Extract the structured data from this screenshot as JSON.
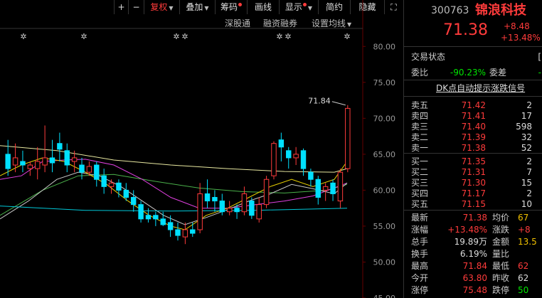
{
  "toolbar": {
    "plus": "+",
    "minus": "−",
    "fuquan": "复权",
    "diejia": "叠加",
    "chouma": "筹码",
    "huaxian": "画线",
    "xianshi": "显示",
    "jianyue": "简约",
    "yincang": "隐藏",
    "expand": "⛶"
  },
  "subbar": {
    "shentongtong": "深股通",
    "rongzi": "融资融券",
    "shezhi": "设置均线"
  },
  "chart_data": {
    "type": "candlestick",
    "y_ticks": [
      "80.00",
      "75.00",
      "70.00",
      "65.00",
      "60.00",
      "55.00",
      "50.00",
      "45.00"
    ],
    "ylim": [
      45,
      82.5
    ],
    "last_price_label": "71.84",
    "candles": [
      {
        "o": 65.0,
        "c": 63.0,
        "h": 67.0,
        "l": 62.0
      },
      {
        "o": 63.5,
        "c": 64.5,
        "h": 66.5,
        "l": 62.5
      },
      {
        "o": 64.0,
        "c": 63.5,
        "h": 65.5,
        "l": 62.5
      },
      {
        "o": 63.0,
        "c": 63.5,
        "h": 64.0,
        "l": 62.0
      },
      {
        "o": 63.0,
        "c": 64.0,
        "h": 66.0,
        "l": 61.5
      },
      {
        "o": 63.5,
        "c": 64.5,
        "h": 69.0,
        "l": 62.5
      },
      {
        "o": 64.5,
        "c": 63.8,
        "h": 67.0,
        "l": 62.5
      },
      {
        "o": 66.5,
        "c": 65.7,
        "h": 68.0,
        "l": 64.0
      },
      {
        "o": 65.5,
        "c": 63.5,
        "h": 66.5,
        "l": 62.5
      },
      {
        "o": 64.0,
        "c": 64.5,
        "h": 65.5,
        "l": 62.5
      },
      {
        "o": 63.5,
        "c": 62.5,
        "h": 64.5,
        "l": 61.5
      },
      {
        "o": 62.5,
        "c": 63.3,
        "h": 64.0,
        "l": 62.0
      },
      {
        "o": 63.5,
        "c": 61.5,
        "h": 64.0,
        "l": 60.5
      },
      {
        "o": 62.0,
        "c": 60.5,
        "h": 63.0,
        "l": 59.5
      },
      {
        "o": 60.5,
        "c": 61.0,
        "h": 61.5,
        "l": 59.5
      },
      {
        "o": 61.0,
        "c": 60.0,
        "h": 61.5,
        "l": 59.0
      },
      {
        "o": 60.0,
        "c": 59.0,
        "h": 61.0,
        "l": 58.5
      },
      {
        "o": 59.0,
        "c": 58.0,
        "h": 60.0,
        "l": 57.0
      },
      {
        "o": 58.0,
        "c": 56.0,
        "h": 58.5,
        "l": 55.5
      },
      {
        "o": 56.5,
        "c": 56.0,
        "h": 57.5,
        "l": 55.5
      },
      {
        "o": 56.5,
        "c": 56.0,
        "h": 57.0,
        "l": 55.0
      },
      {
        "o": 56.0,
        "c": 55.2,
        "h": 57.0,
        "l": 55.0
      },
      {
        "o": 55.5,
        "c": 54.5,
        "h": 56.5,
        "l": 53.5
      },
      {
        "o": 54.5,
        "c": 53.7,
        "h": 55.5,
        "l": 53.0
      },
      {
        "o": 53.5,
        "c": 54.5,
        "h": 55.5,
        "l": 52.5
      },
      {
        "o": 54.5,
        "c": 54.0,
        "h": 55.5,
        "l": 53.5
      },
      {
        "o": 54.5,
        "c": 59.5,
        "h": 61.0,
        "l": 54.0
      },
      {
        "o": 59.5,
        "c": 58.5,
        "h": 61.5,
        "l": 57.5
      },
      {
        "o": 59.0,
        "c": 58.5,
        "h": 60.0,
        "l": 57.0
      },
      {
        "o": 58.5,
        "c": 57.0,
        "h": 59.5,
        "l": 56.5
      },
      {
        "o": 57.0,
        "c": 57.5,
        "h": 58.5,
        "l": 56.5
      },
      {
        "o": 57.5,
        "c": 57.0,
        "h": 58.0,
        "l": 56.0
      },
      {
        "o": 57.0,
        "c": 59.5,
        "h": 60.5,
        "l": 56.5
      },
      {
        "o": 58.5,
        "c": 56.5,
        "h": 59.0,
        "l": 56.0
      },
      {
        "o": 56.0,
        "c": 58.0,
        "h": 59.0,
        "l": 55.5
      },
      {
        "o": 58.0,
        "c": 61.5,
        "h": 62.0,
        "l": 57.5
      },
      {
        "o": 62.0,
        "c": 66.5,
        "h": 66.8,
        "l": 61.5
      },
      {
        "o": 67.0,
        "c": 66.0,
        "h": 68.0,
        "l": 64.0
      },
      {
        "o": 65.5,
        "c": 64.5,
        "h": 66.0,
        "l": 63.0
      },
      {
        "o": 64.5,
        "c": 65.0,
        "h": 66.0,
        "l": 63.5
      },
      {
        "o": 65.5,
        "c": 63.0,
        "h": 65.8,
        "l": 62.0
      },
      {
        "o": 62.5,
        "c": 61.5,
        "h": 63.0,
        "l": 60.5
      },
      {
        "o": 61.5,
        "c": 59.0,
        "h": 62.0,
        "l": 58.0
      },
      {
        "o": 60.0,
        "c": 60.5,
        "h": 61.0,
        "l": 58.5
      },
      {
        "o": 61.0,
        "c": 59.5,
        "h": 61.5,
        "l": 58.5
      },
      {
        "o": 58.5,
        "c": 62.5,
        "h": 63.0,
        "l": 57.5
      },
      {
        "o": 63.0,
        "c": 71.38,
        "h": 71.84,
        "l": 62.5
      }
    ],
    "ma_series": [
      {
        "color": "#e8e8a0",
        "points": [
          [
            0,
            66.2
          ],
          [
            80,
            65.5
          ],
          [
            160,
            64.2
          ],
          [
            240,
            63.5
          ],
          [
            320,
            63.0
          ],
          [
            400,
            62.6
          ],
          [
            470,
            62.5
          ],
          [
            488,
            63.0
          ]
        ]
      },
      {
        "color": "#4ab04a",
        "points": [
          [
            0,
            56.5
          ],
          [
            60,
            60.0
          ],
          [
            110,
            62.0
          ],
          [
            160,
            62.2
          ],
          [
            220,
            61.2
          ],
          [
            280,
            60.3
          ],
          [
            340,
            59.8
          ],
          [
            400,
            59.6
          ],
          [
            460,
            60.0
          ],
          [
            488,
            60.8
          ]
        ]
      },
      {
        "color": "#e040e0",
        "points": [
          [
            0,
            61.5
          ],
          [
            30,
            62.0
          ],
          [
            60,
            64.0
          ],
          [
            90,
            64.2
          ],
          [
            120,
            64.3
          ],
          [
            160,
            63.5
          ],
          [
            200,
            61.5
          ],
          [
            240,
            59.0
          ],
          [
            280,
            57.5
          ],
          [
            320,
            57.5
          ],
          [
            360,
            58.0
          ],
          [
            400,
            58.5
          ],
          [
            440,
            59.2
          ],
          [
            488,
            61.0
          ]
        ]
      },
      {
        "color": "#c8c8c8",
        "points": [
          [
            0,
            56.0
          ],
          [
            40,
            58.5
          ],
          [
            80,
            61.5
          ],
          [
            110,
            62.5
          ],
          [
            140,
            62.0
          ],
          [
            170,
            60.5
          ],
          [
            200,
            58.5
          ],
          [
            230,
            56.5
          ],
          [
            260,
            55.2
          ],
          [
            290,
            56.2
          ],
          [
            320,
            57.3
          ],
          [
            350,
            58.5
          ],
          [
            380,
            59.5
          ],
          [
            410,
            60.8
          ],
          [
            440,
            60.2
          ],
          [
            470,
            59.5
          ],
          [
            488,
            61.0
          ]
        ]
      },
      {
        "color": "#e8d000",
        "points": [
          [
            0,
            62.0
          ],
          [
            30,
            63.5
          ],
          [
            60,
            64.5
          ],
          [
            90,
            64.0
          ],
          [
            120,
            62.5
          ],
          [
            150,
            60.8
          ],
          [
            180,
            58.5
          ],
          [
            210,
            56.5
          ],
          [
            240,
            55.0
          ],
          [
            260,
            54.5
          ],
          [
            290,
            56.5
          ],
          [
            320,
            57.5
          ],
          [
            350,
            59.0
          ],
          [
            380,
            60.5
          ],
          [
            410,
            61.5
          ],
          [
            440,
            60.5
          ],
          [
            470,
            61.5
          ],
          [
            488,
            64.0
          ]
        ]
      },
      {
        "color": "#00c8d8",
        "points": [
          [
            0,
            57.8
          ],
          [
            120,
            57.2
          ],
          [
            240,
            57.1
          ],
          [
            360,
            57.2
          ],
          [
            488,
            57.5
          ]
        ]
      }
    ]
  },
  "quote": {
    "code": "300763",
    "name": "锦浪科技",
    "price": "71.38",
    "change": "+8.48",
    "change_pct": "+13.48%",
    "status_label": "交易状态",
    "weibi_label": "委比",
    "weibi_val": "-90.23%",
    "weicha_label": "委差",
    "weicha_val": "-",
    "signal": "DK点自动提示涨跌信号",
    "asks": [
      {
        "label": "卖五",
        "price": "71.42",
        "vol": "2"
      },
      {
        "label": "卖四",
        "price": "71.41",
        "vol": "17"
      },
      {
        "label": "卖三",
        "price": "71.40",
        "vol": "598"
      },
      {
        "label": "卖二",
        "price": "71.39",
        "vol": "32"
      },
      {
        "label": "卖一",
        "price": "71.38",
        "vol": "52"
      }
    ],
    "bids": [
      {
        "label": "买一",
        "price": "71.35",
        "vol": "2"
      },
      {
        "label": "买二",
        "price": "71.31",
        "vol": "7"
      },
      {
        "label": "买三",
        "price": "71.30",
        "vol": "15"
      },
      {
        "label": "买四",
        "price": "71.17",
        "vol": "2"
      },
      {
        "label": "买五",
        "price": "71.15",
        "vol": "10"
      }
    ],
    "stats": [
      {
        "l1": "最新",
        "v1": "71.38",
        "l2": "均价",
        "v2": "67"
      },
      {
        "l1": "涨幅",
        "v1": "+13.48%",
        "l2": "涨跌",
        "v2": "+8"
      },
      {
        "l1": "总手",
        "v1": "19.89万",
        "l2": "金额",
        "v2": "13.5"
      },
      {
        "l1": "换手",
        "v1": "6.19%",
        "l2": "量比",
        "v2": ""
      },
      {
        "l1": "最高",
        "v1": "71.84",
        "l2": "最低",
        "v2": "62"
      },
      {
        "l1": "今开",
        "v1": "63.80",
        "l2": "昨收",
        "v2": "62"
      },
      {
        "l1": "涨停",
        "v1": "75.48",
        "l2": "跌停",
        "v2": "50"
      }
    ]
  }
}
